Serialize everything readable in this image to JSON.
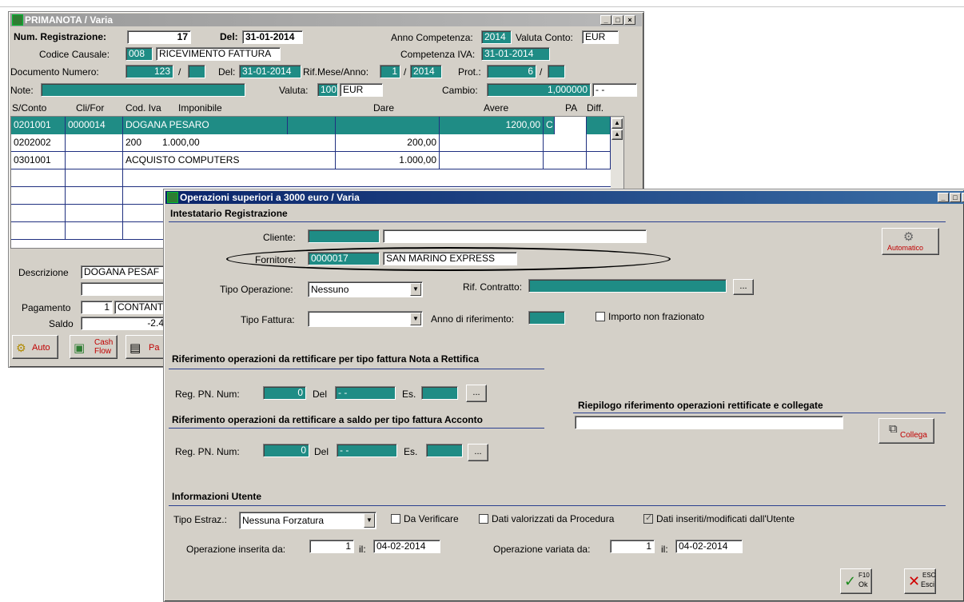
{
  "bg_window": {
    "title": "PRIMANOTA / Varia",
    "num_reg_label": "Num. Registrazione:",
    "num_reg_value": "17",
    "del_label": "Del:",
    "del_value": "31-01-2014",
    "anno_comp_label": "Anno Competenza:",
    "anno_comp_value": "2014",
    "valuta_conto_label": "Valuta Conto:",
    "valuta_conto_value": "EUR",
    "causale_label": "Codice Causale:",
    "causale_code": "008",
    "causale_desc": "RICEVIMENTO FATTURA",
    "comp_iva_label": "Competenza IVA:",
    "comp_iva_value": "31-01-2014",
    "doc_num_label": "Documento Numero:",
    "doc_num_value": "123",
    "slash": "/",
    "doc_del_label": "Del:",
    "doc_del_value": "31-01-2014",
    "rif_mese_label": "Rif.Mese/Anno:",
    "rif_mese_value": "1",
    "rif_anno_value": "2014",
    "prot_label": "Prot.:",
    "prot_value": "6",
    "note_label": "Note:",
    "valuta_label": "Valuta:",
    "valuta_code": "100",
    "valuta_value": "EUR",
    "cambio_label": "Cambio:",
    "cambio_value": "1,000000",
    "cambio_extra": "- -",
    "columns": [
      "S/Conto",
      "Cli/For",
      "Cod. Iva",
      "Imponibile",
      "Dare",
      "Avere",
      "PA",
      "Diff."
    ],
    "rows": [
      {
        "sconto": "0201001",
        "clifor": "0000014",
        "codiva": "DOGANA PESARO",
        "imponibile": "",
        "dare": "",
        "avere": "1200,00",
        "pa": "C",
        "diff": ""
      },
      {
        "sconto": "0202002",
        "clifor": "",
        "codiva": "200",
        "imponibile": "1.000,00",
        "dare": "200,00",
        "avere": "",
        "pa": "",
        "diff": ""
      },
      {
        "sconto": "0301001",
        "clifor": "",
        "codiva": "ACQUISTO COMPUTERS",
        "imponibile": "",
        "dare": "1.000,00",
        "avere": "",
        "pa": "",
        "diff": ""
      }
    ],
    "descrizione_label": "Descrizione",
    "descrizione_value": "DOGANA PESAF",
    "pagamento_label": "Pagamento",
    "pagamento_code": "1",
    "pagamento_desc": "CONTANT",
    "saldo_label": "Saldo",
    "saldo_value": "-2.4",
    "btn_auto": "Auto",
    "btn_cash": "Cash",
    "btn_flow": "Flow",
    "btn_pa": "Pa"
  },
  "dialog": {
    "title": "Operazioni superiori a 3000 euro / Varia",
    "sec_intestatario": "Intestatario Registrazione",
    "cliente_label": "Cliente:",
    "cliente_code": "",
    "cliente_name": "",
    "fornitore_label": "Fornitore:",
    "fornitore_code": "0000017",
    "fornitore_name": "SAN MARINO EXPRESS",
    "automatico_label": "Automatico",
    "tipo_op_label": "Tipo Operazione:",
    "tipo_op_value": "Nessuno",
    "rif_contratto_label": "Rif. Contratto:",
    "dots": "...",
    "tipo_fattura_label": "Tipo Fattura:",
    "tipo_fattura_value": "",
    "anno_rif_label": "Anno di riferimento:",
    "importo_label": "Importo non frazionato",
    "sec_rettifica": "Riferimento operazioni da rettificare per tipo fattura Nota a Rettifica",
    "reg_pn_label": "Reg. PN. Num:",
    "reg_pn_value": "0",
    "del_label": "Del",
    "del_value": "- -",
    "es_label": "Es.",
    "sec_riepilogo": "Riepilogo riferimento operazioni rettificate e collegate",
    "collega_label": "Collega",
    "sec_acconto": "Riferimento operazioni da rettificare a saldo per tipo fattura Acconto",
    "reg_pn2_value": "0",
    "del2_value": "- -",
    "sec_info": "Informazioni Utente",
    "tipo_estraz_label": "Tipo Estraz.:",
    "tipo_estraz_value": "Nessuna Forzatura",
    "da_verificare": "Da Verificare",
    "dati_procedura": "Dati valorizzati da Procedura",
    "dati_utente": "Dati inseriti/modificati dall'Utente",
    "op_inserita_label": "Operazione inserita da:",
    "op_inserita_user": "1",
    "il_label": "il:",
    "op_inserita_date": "04-02-2014",
    "op_variata_label": "Operazione variata da:",
    "op_variata_user": "1",
    "op_variata_date": "04-02-2014",
    "ok_key": "F10",
    "ok_label": "Ok",
    "esc_key": "ESC",
    "esc_label": "Esci"
  }
}
